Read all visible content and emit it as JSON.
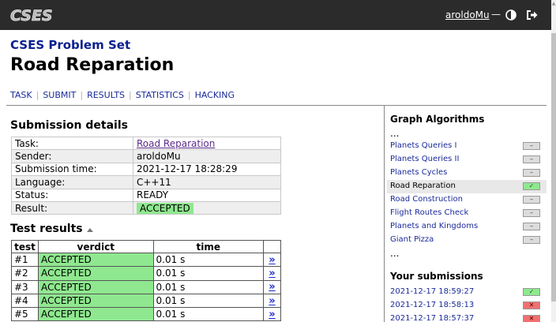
{
  "header": {
    "logo_text": "CSES",
    "username": "aroldoMu",
    "separator": "—",
    "theme_icon": "contrast-icon",
    "logout_icon": "logout-icon"
  },
  "problem_set_title": "CSES Problem Set",
  "task_title": "Road Reparation",
  "nav": [
    "TASK",
    "SUBMIT",
    "RESULTS",
    "STATISTICS",
    "HACKING"
  ],
  "submission": {
    "heading": "Submission details",
    "rows": [
      {
        "key": "Task:",
        "value": "Road Reparation"
      },
      {
        "key": "Sender:",
        "value": "aroldoMu"
      },
      {
        "key": "Submission time:",
        "value": "2021-12-17 18:28:29"
      },
      {
        "key": "Language:",
        "value": "C++11"
      },
      {
        "key": "Status:",
        "value": "READY"
      },
      {
        "key": "Result:",
        "value": "ACCEPTED"
      }
    ]
  },
  "tests": {
    "heading": "Test results",
    "columns": [
      "test",
      "verdict",
      "time"
    ],
    "more_glyph": "»",
    "rows": [
      {
        "test": "#1",
        "verdict": "ACCEPTED",
        "time": "0.01 s"
      },
      {
        "test": "#2",
        "verdict": "ACCEPTED",
        "time": "0.01 s"
      },
      {
        "test": "#3",
        "verdict": "ACCEPTED",
        "time": "0.01 s"
      },
      {
        "test": "#4",
        "verdict": "ACCEPTED",
        "time": "0.01 s"
      },
      {
        "test": "#5",
        "verdict": "ACCEPTED",
        "time": "0.01 s"
      }
    ]
  },
  "sidebar": {
    "heading": "Graph Algorithms",
    "ellipsis": "...",
    "items": [
      {
        "label": "Planets Queries I",
        "status": "none",
        "mark": "–"
      },
      {
        "label": "Planets Queries II",
        "status": "none",
        "mark": "–"
      },
      {
        "label": "Planets Cycles",
        "status": "none",
        "mark": "–"
      },
      {
        "label": "Road Reparation",
        "status": "ok",
        "mark": "✓"
      },
      {
        "label": "Road Construction",
        "status": "none",
        "mark": "–"
      },
      {
        "label": "Flight Routes Check",
        "status": "none",
        "mark": "–"
      },
      {
        "label": "Planets and Kingdoms",
        "status": "none",
        "mark": "–"
      },
      {
        "label": "Giant Pizza",
        "status": "none",
        "mark": "–"
      }
    ],
    "submissions_heading": "Your submissions",
    "submissions": [
      {
        "time": "2021-12-17 18:59:27",
        "status": "ok",
        "mark": "✓"
      },
      {
        "time": "2021-12-17 18:58:13",
        "status": "bad",
        "mark": "✕"
      },
      {
        "time": "2021-12-17 18:57:37",
        "status": "bad",
        "mark": "✕"
      }
    ]
  },
  "colors": {
    "accepted": "#8fe88f",
    "rejected": "#f07070",
    "link": "#1a2a9a",
    "topbar": "#2b2b2b"
  }
}
